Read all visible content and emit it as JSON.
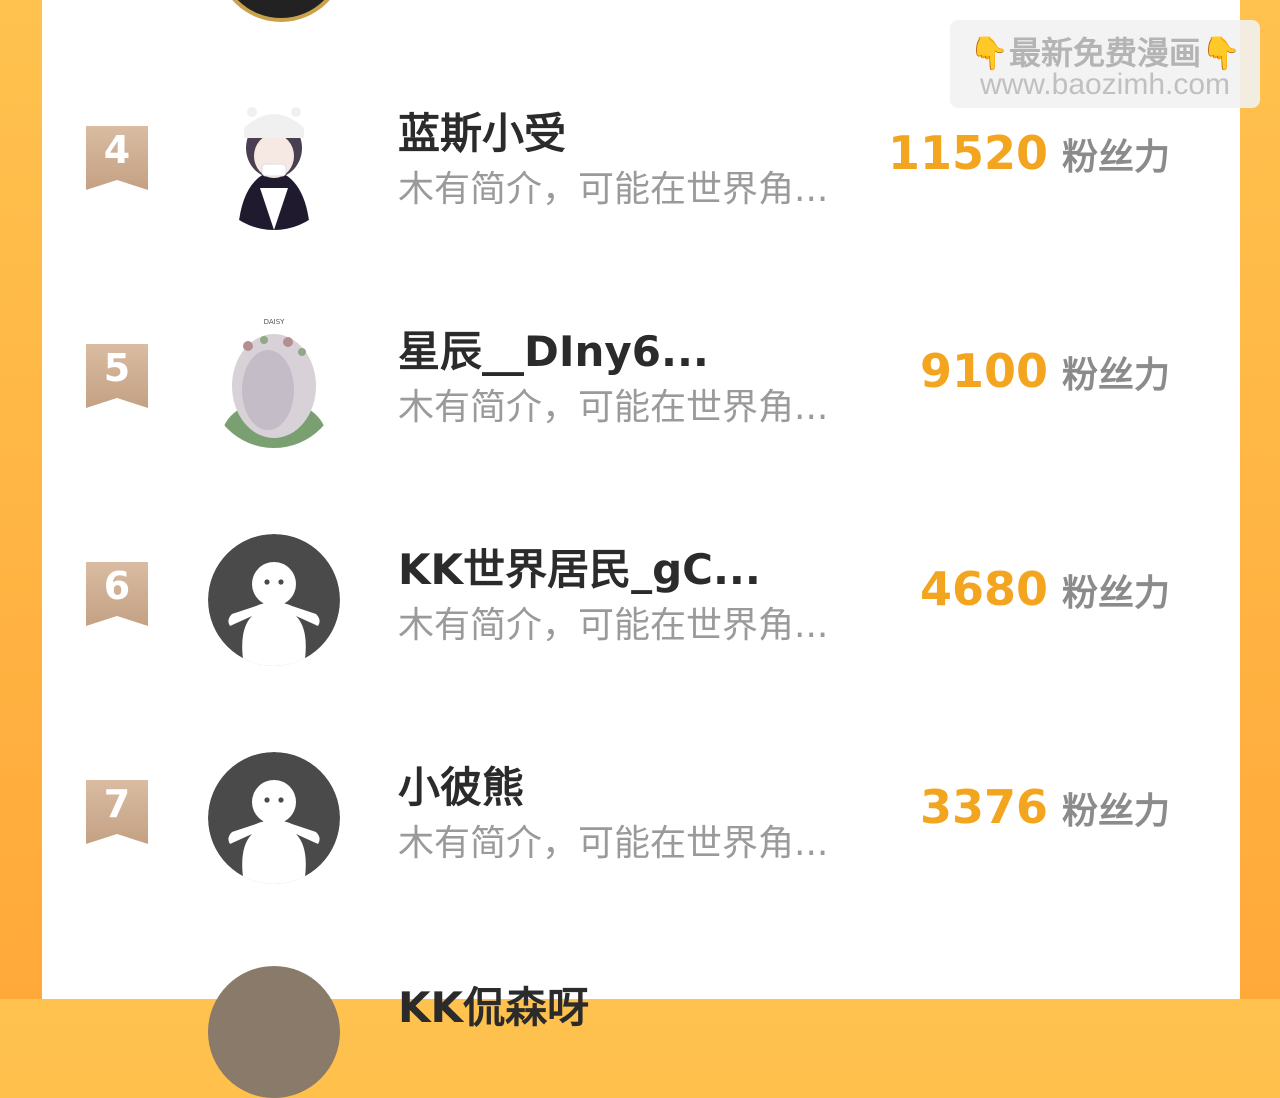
{
  "watermark": {
    "line1": "最新免费漫画",
    "hand_left": "👇",
    "hand_right": "👇",
    "line2": "www.baozimh.com"
  },
  "rows": [
    {
      "rank": "4",
      "name": "蓝斯小受",
      "desc": "木有简介，可能在世界角...",
      "score": "11520",
      "unit": "粉丝力",
      "avatar": "anime-girl-icon"
    },
    {
      "rank": "5",
      "name": "星辰__DIny6...",
      "desc": "木有简介，可能在世界角...",
      "score": "9100",
      "unit": "粉丝力",
      "avatar": "flower-girl-icon"
    },
    {
      "rank": "6",
      "name": "KK世界居民_gC...",
      "desc": "木有简介，可能在世界角...",
      "score": "4680",
      "unit": "粉丝力",
      "avatar": "default-avatar-icon"
    },
    {
      "rank": "7",
      "name": "小彼熊",
      "desc": "木有简介，可能在世界角...",
      "score": "3376",
      "unit": "粉丝力",
      "avatar": "default-avatar-icon"
    }
  ],
  "bottom_partial_name": "KK侃森呀",
  "colors": {
    "accent": "#f3a51f",
    "badge": "#c9a98d",
    "frame": "#ffb23c"
  }
}
